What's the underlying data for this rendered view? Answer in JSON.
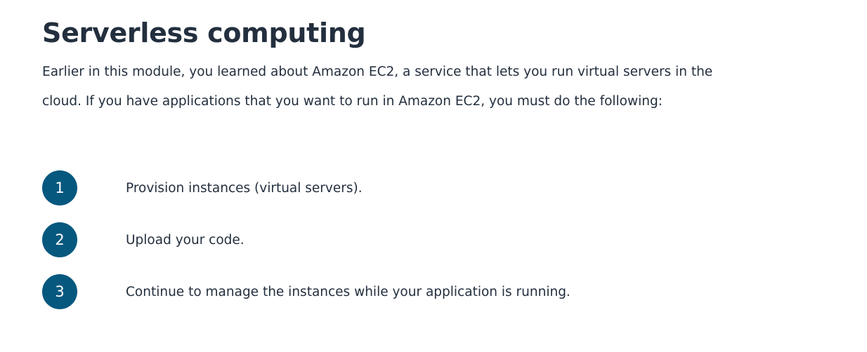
{
  "page": {
    "title": "Serverless computing",
    "intro": "Earlier in this module, you learned about Amazon EC2, a service that lets you run virtual servers in the cloud. If you have applications that you want to run in Amazon EC2, you must do the following:"
  },
  "steps": [
    {
      "number": "1",
      "text": "Provision instances (virtual servers)."
    },
    {
      "number": "2",
      "text": "Upload your code."
    },
    {
      "number": "3",
      "text": "Continue to manage the instances while your application is running."
    }
  ],
  "colors": {
    "accent": "#06587f",
    "text": "#232f3e"
  }
}
